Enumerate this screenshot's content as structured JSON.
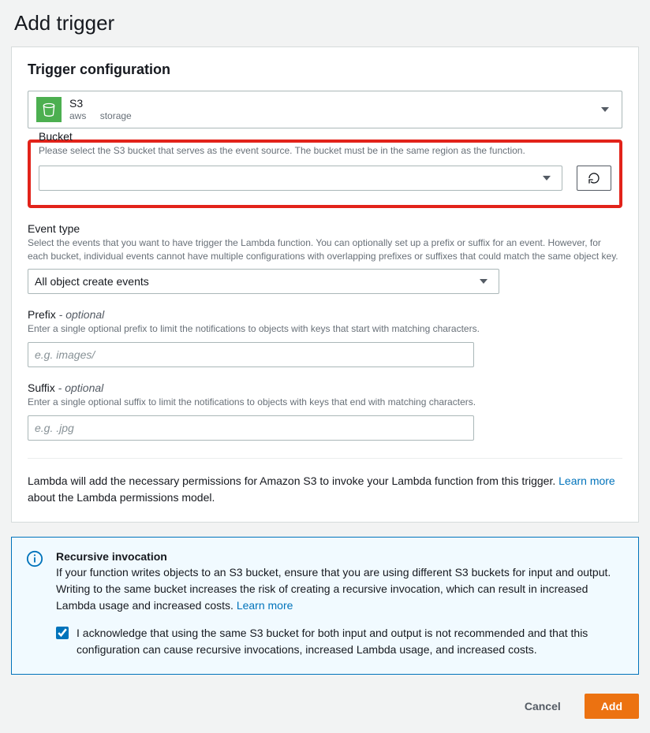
{
  "page": {
    "title": "Add trigger"
  },
  "panel": {
    "header": "Trigger configuration"
  },
  "source": {
    "name": "S3",
    "tag1": "aws",
    "tag2": "storage"
  },
  "bucket": {
    "label": "Bucket",
    "desc": "Please select the S3 bucket that serves as the event source. The bucket must be in the same region as the function.",
    "value": ""
  },
  "eventType": {
    "label": "Event type",
    "desc": "Select the events that you want to have trigger the Lambda function. You can optionally set up a prefix or suffix for an event. However, for each bucket, individual events cannot have multiple configurations with overlapping prefixes or suffixes that could match the same object key.",
    "value": "All object create events"
  },
  "prefix": {
    "label": "Prefix",
    "optional": " - optional",
    "desc": "Enter a single optional prefix to limit the notifications to objects with keys that start with matching characters.",
    "placeholder": "e.g. images/"
  },
  "suffix": {
    "label": "Suffix",
    "optional": " - optional",
    "desc": "Enter a single optional suffix to limit the notifications to objects with keys that end with matching characters.",
    "placeholder": "e.g. .jpg"
  },
  "permissions": {
    "text1": "Lambda will add the necessary permissions for Amazon S3 to invoke your Lambda function from this trigger. ",
    "link": "Learn more",
    "text2": " about the Lambda permissions model."
  },
  "alert": {
    "title": "Recursive invocation",
    "text1": "If your function writes objects to an S3 bucket, ensure that you are using different S3 buckets for input and output. Writing to the same bucket increases the risk of creating a recursive invocation, which can result in increased Lambda usage and increased costs. ",
    "link": "Learn more",
    "ack": "I acknowledge that using the same S3 bucket for both input and output is not recommended and that this configuration can cause recursive invocations, increased Lambda usage, and increased costs."
  },
  "footer": {
    "cancel": "Cancel",
    "add": "Add"
  }
}
